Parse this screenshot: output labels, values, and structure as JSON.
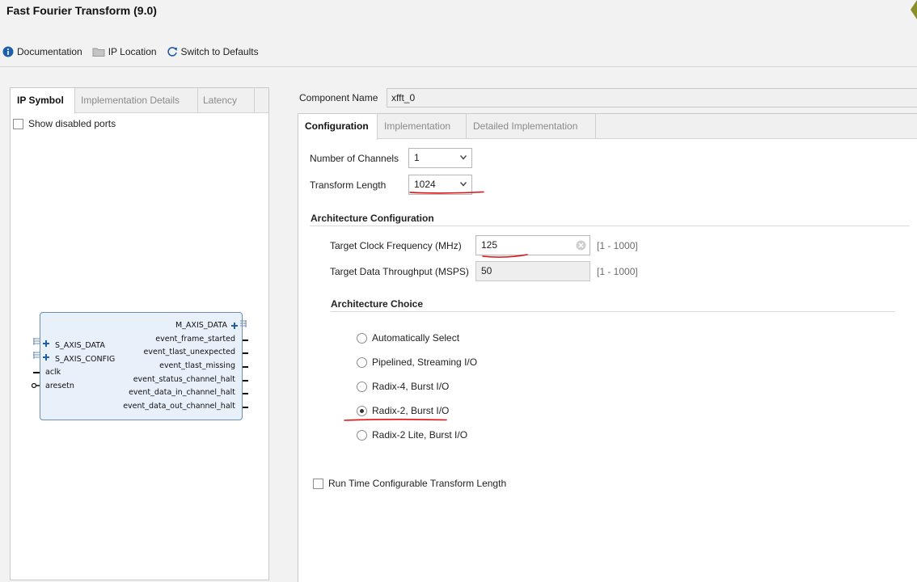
{
  "window": {
    "title": "Fast Fourier Transform (9.0)"
  },
  "toolbar": {
    "documentation": "Documentation",
    "ip_location": "IP Location",
    "switch_defaults": "Switch to Defaults"
  },
  "left_panel": {
    "tabs": [
      "IP Symbol",
      "Implementation Details",
      "Latency"
    ],
    "active_tab": "IP Symbol",
    "show_disabled_ports": {
      "label": "Show disabled ports",
      "checked": false
    },
    "symbol": {
      "left_ports": [
        "S_AXIS_DATA",
        "S_AXIS_CONFIG",
        "aclk",
        "aresetn"
      ],
      "right_ports": [
        "M_AXIS_DATA",
        "event_frame_started",
        "event_tlast_unexpected",
        "event_tlast_missing",
        "event_status_channel_halt",
        "event_data_in_channel_halt",
        "event_data_out_channel_halt"
      ]
    }
  },
  "component": {
    "label": "Component Name",
    "value": "xfft_0"
  },
  "right_panel": {
    "tabs": [
      "Configuration",
      "Implementation",
      "Detailed Implementation"
    ],
    "active_tab": "Configuration",
    "channels": {
      "label": "Number of Channels",
      "value": "1"
    },
    "transform_length": {
      "label": "Transform Length",
      "value": "1024"
    },
    "arch_config": {
      "title": "Architecture Configuration",
      "clock": {
        "label": "Target Clock Frequency (MHz)",
        "value": "125",
        "range": "[1 - 1000]"
      },
      "throughput": {
        "label": "Target Data Throughput (MSPS)",
        "value": "50",
        "range": "[1 - 1000]"
      }
    },
    "arch_choice": {
      "title": "Architecture Choice",
      "options": [
        "Automatically Select",
        "Pipelined, Streaming I/O",
        "Radix-4, Burst I/O",
        "Radix-2, Burst I/O",
        "Radix-2 Lite, Burst I/O"
      ],
      "selected": "Radix-2, Burst I/O"
    },
    "runtime_config": {
      "label": "Run Time Configurable Transform Length",
      "checked": false
    }
  },
  "colors": {
    "accent_blue": "#1f5fa8",
    "annotation_red": "#e01010",
    "symbol_fill": "#e8f0fa"
  }
}
